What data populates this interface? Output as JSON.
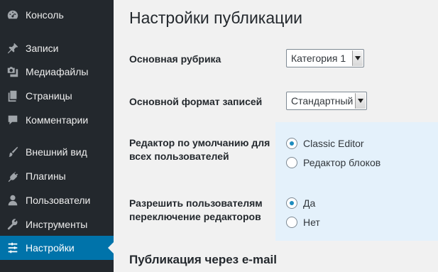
{
  "sidebar": {
    "items": [
      {
        "label": "Консоль",
        "icon": "dashboard-icon"
      },
      {
        "label": "Записи",
        "icon": "pin-icon"
      },
      {
        "label": "Медиафайлы",
        "icon": "media-icon"
      },
      {
        "label": "Страницы",
        "icon": "pages-icon"
      },
      {
        "label": "Комментарии",
        "icon": "comment-icon"
      },
      {
        "label": "Внешний вид",
        "icon": "brush-icon"
      },
      {
        "label": "Плагины",
        "icon": "plugin-icon"
      },
      {
        "label": "Пользователи",
        "icon": "user-icon"
      },
      {
        "label": "Инструменты",
        "icon": "wrench-icon"
      },
      {
        "label": "Настройки",
        "icon": "settings-icon",
        "active": true
      }
    ]
  },
  "page": {
    "title": "Настройки публикации",
    "default_category": {
      "label": "Основная рубрика",
      "value": "Категория 1"
    },
    "default_format": {
      "label": "Основной формат записей",
      "value": "Стандартный"
    },
    "default_editor": {
      "label": "Редактор по умолчанию для всех пользователей",
      "options": [
        "Classic Editor",
        "Редактор блоков"
      ],
      "selected": "Classic Editor"
    },
    "allow_switch": {
      "label": "Разрешить пользователям переключение редакторов",
      "options": [
        "Да",
        "Нет"
      ],
      "selected": "Да"
    },
    "email_section_title": "Публикация через e-mail"
  },
  "colors": {
    "sidebar_bg": "#23282d",
    "active_bg": "#0073aa",
    "highlight_bg": "#e4f1fb",
    "radio_checked": "#1e8cbe"
  }
}
